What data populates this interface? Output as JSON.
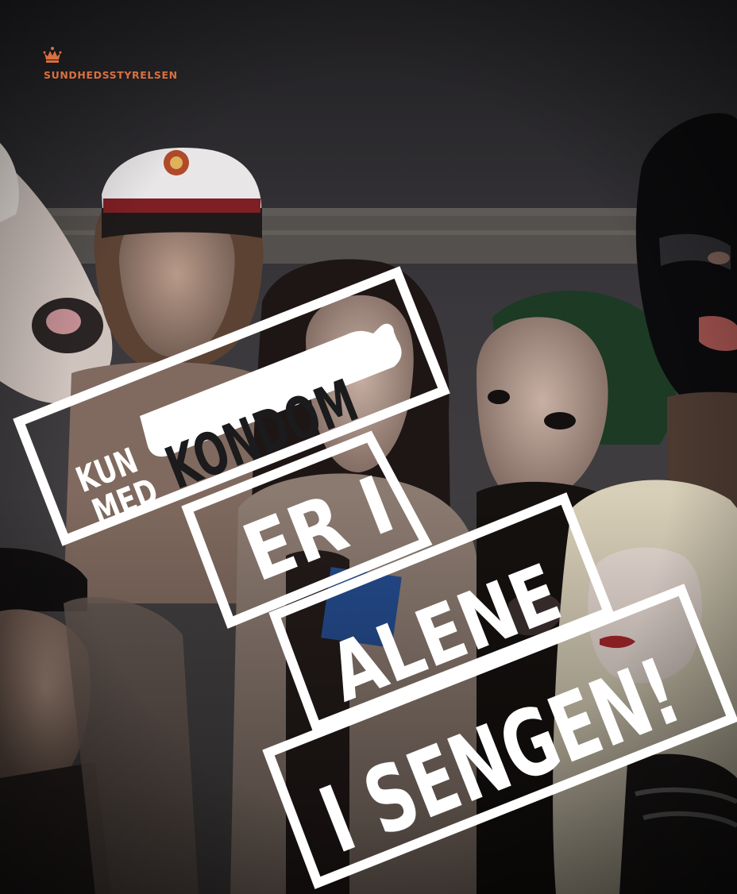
{
  "logo": {
    "icon": "crown-icon",
    "text": "SUNDHEDSSTYRELSEN",
    "color": "#d9703f"
  },
  "campaign": {
    "kun": "KUN",
    "med": "MED",
    "kondom": "KONDOM",
    "line1": "ER I",
    "line2": "ALENE",
    "line3": "I SENGEN!"
  },
  "colors": {
    "headline": "#ffffff",
    "background": "#1b1a1c"
  }
}
